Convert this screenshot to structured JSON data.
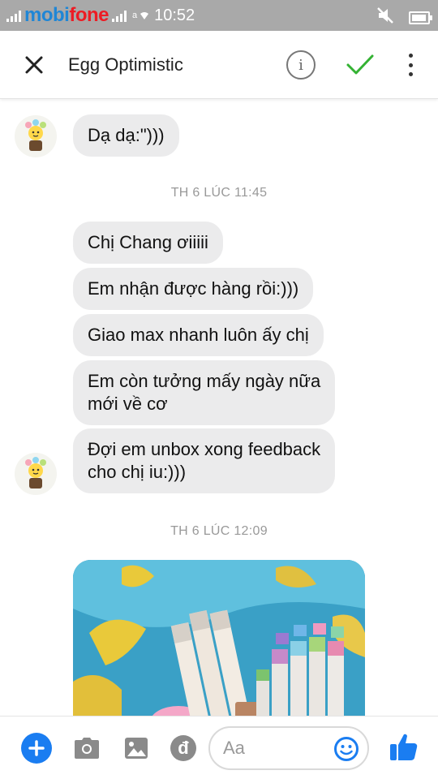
{
  "status_bar": {
    "carrier_left": "mobi",
    "carrier_right": "fone",
    "extra": "a",
    "time": "10:52"
  },
  "header": {
    "title": "Egg Optimistic",
    "info_glyph": "i"
  },
  "messages": [
    {
      "text": "Dạ dạ:\")))"
    },
    {
      "text": "Chị Chang ơiiiii"
    },
    {
      "text": "Em nhận được hàng rồi:)))"
    },
    {
      "text": "Giao max nhanh luôn ấy chị"
    },
    {
      "line1": "Em còn tưởng mấy ngày nữa",
      "line2": "mới về cơ"
    },
    {
      "line1": "Đợi em unbox xong feedback",
      "line2": "cho chị iu:)))"
    }
  ],
  "timestamps": [
    "TH 6 LÚC 11:45",
    "TH 6 LÚC 12:09"
  ],
  "composer": {
    "placeholder": "Aa",
    "currency_glyph": "đ"
  },
  "colors": {
    "accent": "#1a7df1",
    "bubble": "#ebebec",
    "check": "#34b233",
    "status_bar": "#a9a9a9"
  },
  "icons": [
    "close-icon",
    "info-icon",
    "checkmark-icon",
    "more-vertical-icon",
    "plus-icon",
    "camera-icon",
    "image-icon",
    "payment-icon",
    "emoji-icon",
    "like-icon",
    "avatar-icon"
  ]
}
